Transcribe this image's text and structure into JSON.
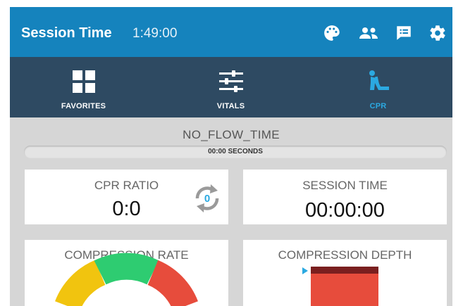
{
  "header": {
    "title": "Session Time",
    "time": "1:49:00",
    "icons": [
      "palette-icon",
      "users-icon",
      "chat-icon",
      "gear-icon"
    ]
  },
  "tabs": [
    {
      "label": "FAVORITES",
      "icon": "grid-icon",
      "active": false
    },
    {
      "label": "VITALS",
      "icon": "sliders-icon",
      "active": false
    },
    {
      "label": "CPR",
      "icon": "cpr-person-icon",
      "active": true
    }
  ],
  "no_flow": {
    "title": "NO_FLOW_TIME",
    "bar_text": "00:00 SECONDS",
    "progress": 0
  },
  "cpr_ratio": {
    "label": "CPR RATIO",
    "value": "0:0",
    "cycle_count": "0"
  },
  "session_time": {
    "label": "SESSION TIME",
    "value": "00:00:00"
  },
  "compression_rate": {
    "label": "COMPRESSION RATE",
    "gauge_colors": [
      "#f1c40f",
      "#2ecc71",
      "#e74c3c"
    ]
  },
  "compression_depth": {
    "label": "COMPRESSION DEPTH",
    "colors": {
      "top_band": "#7a1f1f",
      "zone": "#e74c3c",
      "marker": "#2ba9e1"
    }
  },
  "colors": {
    "header": "#1583bd",
    "nav": "#2e4a62",
    "accent": "#2ba9e1",
    "background": "#d6d6d6"
  }
}
